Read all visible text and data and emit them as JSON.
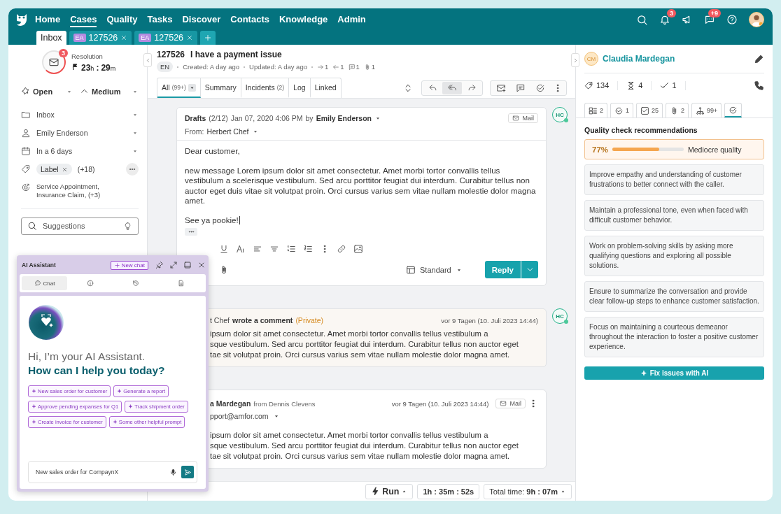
{
  "nav": {
    "items": [
      {
        "label": "Home",
        "selected": false
      },
      {
        "label": "Cases",
        "selected": true
      },
      {
        "label": "Quality",
        "selected": false
      },
      {
        "label": "Tasks",
        "selected": false
      },
      {
        "label": "Discover",
        "selected": false
      },
      {
        "label": "Contacts",
        "selected": false
      },
      {
        "label": "Knowledge",
        "selected": false
      },
      {
        "label": "Admin",
        "selected": false
      }
    ],
    "notifications_badge": "3",
    "messages_badge": "+9"
  },
  "tabs": [
    {
      "kind": "inbox",
      "label": "Inbox",
      "selected": true
    },
    {
      "kind": "case",
      "initials": "EA",
      "label": "127526",
      "selected": false
    },
    {
      "kind": "case",
      "initials": "EA",
      "label": "127526",
      "selected": false
    }
  ],
  "sidebar": {
    "sla": {
      "badge": "3",
      "label": "Resolution",
      "time": [
        {
          "value": "23",
          "unit": "h"
        },
        {
          "value": "29",
          "unit": "m"
        }
      ],
      "separator": ":"
    },
    "status": "Open",
    "priority": "Medium",
    "fields": [
      {
        "kind": "folder",
        "value": "Inbox"
      },
      {
        "kind": "person",
        "value": "Emily Enderson"
      },
      {
        "kind": "calendar",
        "value": "In a 6 days"
      }
    ],
    "label_chip": "Label",
    "label_more": "(+18)",
    "categories": "Service Appointment, Insurance Claim, (+3)",
    "search": {
      "placeholder": "Suggestions"
    }
  },
  "case": {
    "id": "127526",
    "title": "I have a payment issue",
    "language": "EN",
    "created": "Created: A day ago",
    "updated": "Updated: A day ago",
    "counters": [
      {
        "kind": "outgoing",
        "value": "1"
      },
      {
        "kind": "incoming",
        "value": "1"
      },
      {
        "kind": "comments",
        "value": "1"
      },
      {
        "kind": "attachments",
        "value": "1"
      }
    ],
    "tabs": [
      {
        "label": "All",
        "count": "(99+)",
        "selected": true
      },
      {
        "label": "Summary",
        "selected": false
      },
      {
        "label": "Incidents",
        "count": "(2)",
        "selected": false
      },
      {
        "label": "Log",
        "selected": false
      },
      {
        "label": "Linked",
        "selected": false
      }
    ],
    "reply_actions": [
      {
        "kind": "reply",
        "selected": false
      },
      {
        "kind": "reply_all",
        "selected": true
      },
      {
        "kind": "forward",
        "selected": false
      }
    ]
  },
  "draft": {
    "title": "Drafts",
    "count": "(2/12)",
    "date": "Jan 07, 2020 4:06 PM",
    "by": "by",
    "author": "Emily Enderson",
    "channel": "Mail",
    "from_label": "From:",
    "from": "Herbert Chef",
    "body": [
      "Dear customer,",
      "new message Lorem ipsum dolor sit amet consectetur. Amet morbi tortor convallis tellus vestibulum a scelerisque vestibulum. Sed arcu porttitor feugiat dui interdum. Curabitur tellus non auctor eget duis vitae sit volutpat proin. Orci cursus varius sem vitae nullam molestie dolor magna amet.",
      "See ya pookie!"
    ],
    "template": "Standard",
    "reply": "Reply",
    "avatar": "HC"
  },
  "comment": {
    "author": "t Chef",
    "action": "wrote a comment",
    "visibility": "(Private)",
    "date": "vor 9 Tagen (10. Juli 2023 14:44)",
    "avatar": "HC",
    "lines": [
      "ipsum dolor sit amet consectetur. Amet morbi tortor convallis tellus vestibulum a",
      "sque vestibulum. Sed arcu porttitor feugiat dui interdum. Curabitur tellus non auctor eget",
      "tae sit volutpat proin. Orci cursus varius sem vitae nullam molestie dolor magna amet."
    ]
  },
  "mail": {
    "author": "a Mardegan",
    "source": "from Dennis Clevens",
    "date": "vor 9 Tagen (10. Juli 2023 14:44)",
    "channel": "Mail",
    "address": "pport@amfor.com",
    "lines": [
      "ipsum dolor sit amet consectetur. Amet morbi tortor convallis tellus vestibulum a",
      "sque vestibulum. Sed arcu porttitor feugiat dui interdum. Curabitur tellus non auctor eget",
      "tae sit volutpat proin. Orci cursus varius sem vitae nullam molestie dolor magna amet."
    ]
  },
  "footer": {
    "run": "Run",
    "timer": "1h : 35m : 52s",
    "total_label": "Total time:",
    "total": "9h : 07m"
  },
  "contact": {
    "initials": "CM",
    "name": "Claudia Mardegan",
    "stats": [
      {
        "kind": "tickets",
        "value": "134"
      },
      {
        "kind": "pending",
        "value": "4"
      },
      {
        "kind": "done",
        "value": "1"
      }
    ],
    "tabs": [
      {
        "kind": "grid",
        "count": "2",
        "selected": false
      },
      {
        "kind": "badge",
        "count": "1",
        "selected": false
      },
      {
        "kind": "checkbox",
        "count": "25",
        "selected": false
      },
      {
        "kind": "clip",
        "count": "2",
        "selected": false
      },
      {
        "kind": "hierarchy",
        "count": "99+",
        "selected": false
      },
      {
        "kind": "quality",
        "selected": true
      }
    ]
  },
  "quality": {
    "title": "Quality check recommendations",
    "score": "77%",
    "level": 0.66,
    "rating": "Mediocre quality",
    "recommendations": [
      "Improve empathy and understanding of customer frustrations to better connect with the caller.",
      "Maintain a professional tone, even when faced with difficult customer behavior.",
      "Work on problem-solving skills by asking more qualifying questions and exploring all possible solutions.",
      "Ensure to summarize the conversation and provide clear follow-up steps to enhance customer satisfaction.",
      "Focus on maintaining a courteous demeanor throughout the interaction to foster a positive customer experience."
    ],
    "action": "Fix issues with AI"
  },
  "assistant": {
    "title": "AI Assistant",
    "new_chat": "New chat",
    "tabs": [
      {
        "kind": "chat",
        "label": "Chat",
        "selected": true
      },
      {
        "kind": "info",
        "selected": false
      },
      {
        "kind": "history",
        "selected": false
      },
      {
        "kind": "document",
        "selected": false
      }
    ],
    "greeting": "Hi, I’m your AI Assistant.",
    "question": "How can I help you today?",
    "prompts": [
      "New sales order for customer",
      "Generate a report",
      "Approve pending expanses for Q1",
      "Track shipment order",
      "Create invoice for customer",
      "Some other helpful prompt"
    ],
    "input": {
      "value": "New sales order for CompaynX"
    }
  }
}
